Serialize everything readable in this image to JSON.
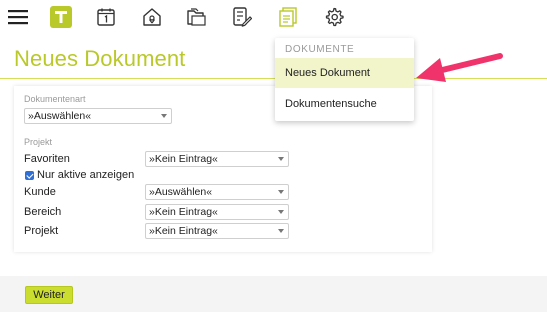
{
  "toolbar": {
    "icons": [
      "hamburger-menu-icon",
      "app-logo-t-icon",
      "calendar-icon",
      "home-location-icon",
      "folders-icon",
      "checklist-edit-icon",
      "documents-icon",
      "gear-icon"
    ],
    "accent_color": "#b9c92a",
    "logo_letter": "T"
  },
  "page": {
    "title": "Neues Dokument"
  },
  "form": {
    "dokumentenart_label": "Dokumentenart",
    "dokumentenart_value": "»Auswählen«",
    "projekt_section_label": "Projekt",
    "favoriten_label": "Favoriten",
    "favoriten_value": "»Kein Eintrag«",
    "nur_aktive_label": "Nur aktive anzeigen",
    "nur_aktive_checked": true,
    "kunde_label": "Kunde",
    "kunde_value": "»Auswählen«",
    "bereich_label": "Bereich",
    "bereich_value": "»Kein Eintrag«",
    "projekt_label": "Projekt",
    "projekt_value": "»Kein Eintrag«"
  },
  "footer": {
    "weiter_label": "Weiter"
  },
  "menu": {
    "header": "DOKUMENTE",
    "items": [
      {
        "label": "Neues Dokument",
        "active": true
      },
      {
        "label": "Dokumentensuche",
        "active": false
      }
    ]
  },
  "annotation": {
    "arrow_color": "#f0336b"
  }
}
